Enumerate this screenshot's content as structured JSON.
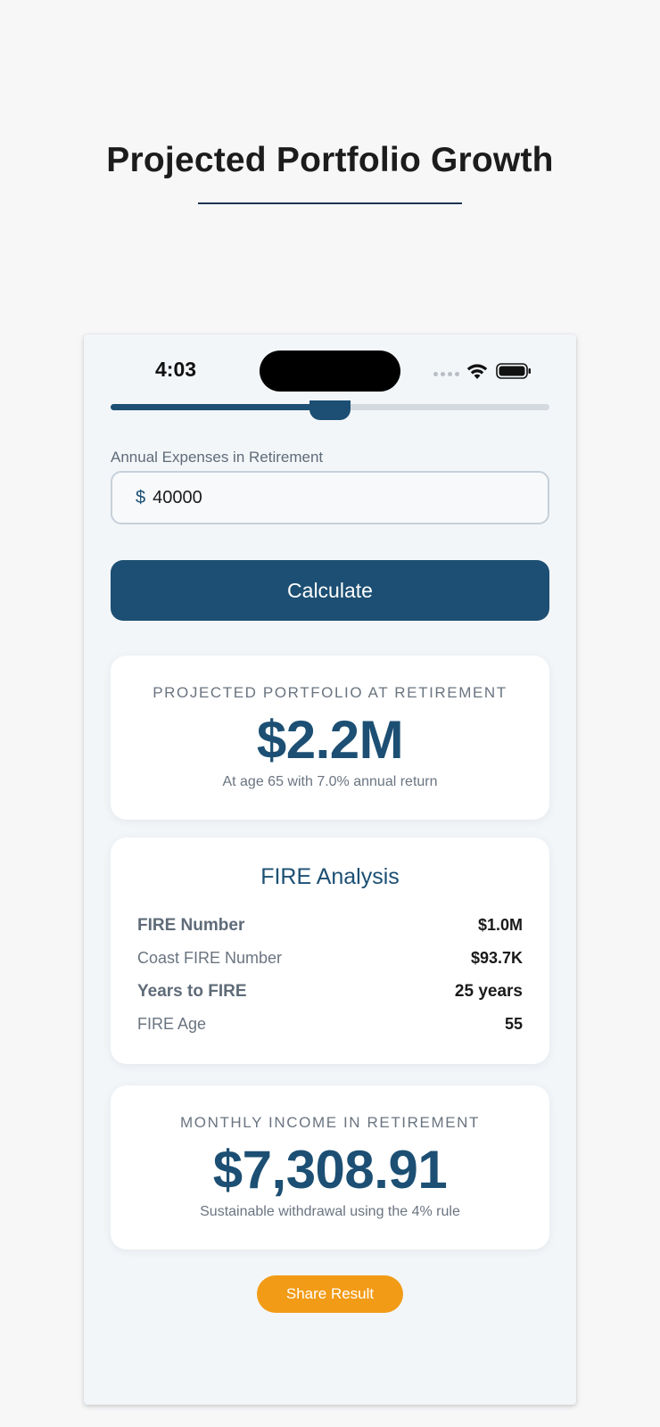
{
  "page": {
    "title": "Projected Portfolio Growth"
  },
  "status_bar": {
    "time": "4:03",
    "icons": [
      "signal-dots-icon",
      "wifi-icon",
      "battery-icon"
    ]
  },
  "slider": {
    "fraction": 0.5
  },
  "expenses": {
    "label": "Annual Expenses in Retirement",
    "currency_symbol": "$",
    "value": "40000"
  },
  "calculate": {
    "label": "Calculate"
  },
  "projected": {
    "eyebrow": "PROJECTED PORTFOLIO AT RETIREMENT",
    "amount": "$2.2M",
    "note": "At age 65 with 7.0% annual return"
  },
  "fire": {
    "title": "FIRE Analysis",
    "rows": [
      {
        "label": "FIRE Number",
        "value": "$1.0M"
      },
      {
        "label": "Coast FIRE Number",
        "value": "$93.7K"
      },
      {
        "label": "Years to FIRE",
        "value": "25 years"
      },
      {
        "label": "FIRE Age",
        "value": "55"
      }
    ]
  },
  "income": {
    "eyebrow": "MONTHLY INCOME IN RETIREMENT",
    "amount": "$7,308.91",
    "note": "Sustainable withdrawal using the 4% rule"
  },
  "share": {
    "label": "Share Result"
  },
  "colors": {
    "primary": "#1c4f73",
    "accent": "#f29b16",
    "muted": "#6a7480"
  }
}
